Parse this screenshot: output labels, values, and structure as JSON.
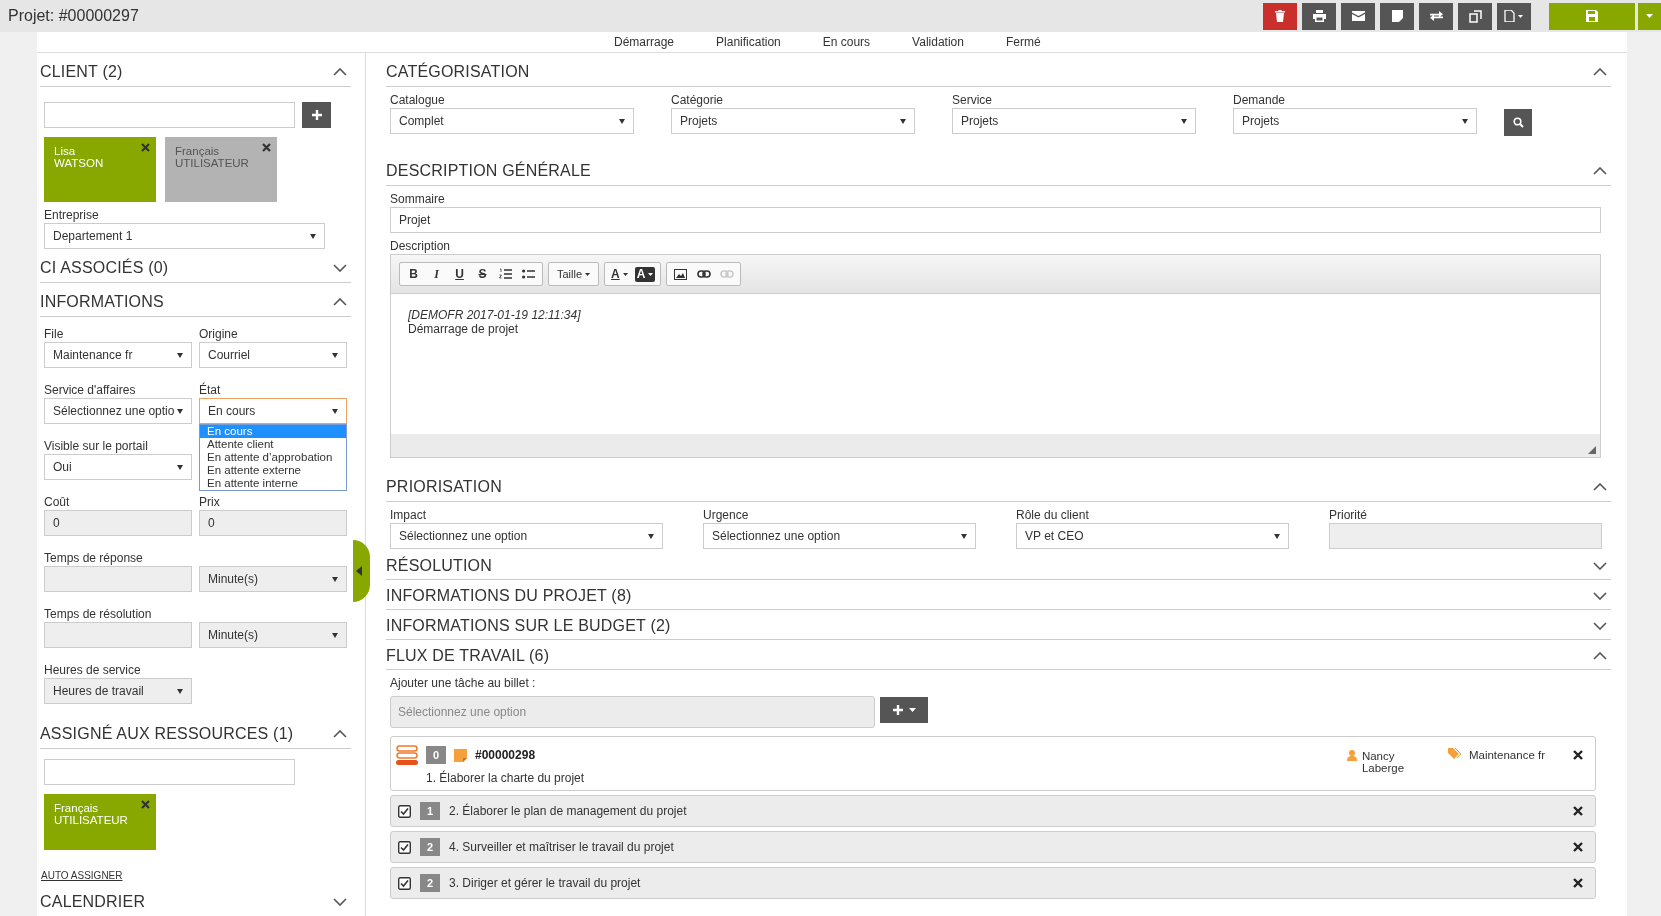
{
  "title": "Projet: #00000297",
  "toolbar": [
    {
      "kind": "delete"
    },
    {
      "kind": "print"
    },
    {
      "kind": "mail"
    },
    {
      "kind": "note"
    },
    {
      "kind": "swap"
    },
    {
      "kind": "copy"
    },
    {
      "kind": "file"
    }
  ],
  "phases": [
    "Démarrage",
    "Planification",
    "En cours",
    "Validation",
    "Fermé"
  ],
  "client": {
    "title": "CLIENT (2)",
    "expanded": true,
    "tags": [
      {
        "first": "Lisa",
        "last": "WATSON",
        "color": "#88a800"
      },
      {
        "first": "Français",
        "last": "UTILISATEUR",
        "color": "#b3b3b3"
      }
    ],
    "company_label": "Entreprise",
    "company": "Departement 1"
  },
  "ci": {
    "title": "CI ASSOCIÉS (0)",
    "expanded": false
  },
  "informations": {
    "title": "INFORMATIONS",
    "expanded": true,
    "rows": [
      {
        "cells": [
          {
            "label": "File",
            "value": "Maintenance fr",
            "kind": "select",
            "disabled": false
          },
          {
            "label": "Origine",
            "value": "Courriel",
            "kind": "select",
            "disabled": false
          }
        ]
      },
      {
        "cells": [
          {
            "label": "Service d'affaires",
            "value": "Sélectionnez une optio",
            "kind": "select",
            "disabled": false
          },
          {
            "label": "État",
            "value": "En cours",
            "kind": "select",
            "disabled": false,
            "open": true,
            "options": [
              {
                "label": "En cours",
                "selected": true
              },
              {
                "label": "Attente client",
                "selected": false
              },
              {
                "label": "En attente d’approbation",
                "selected": false
              },
              {
                "label": "En attente externe",
                "selected": false
              },
              {
                "label": "En attente interne",
                "selected": false
              }
            ]
          }
        ]
      },
      {
        "cells": [
          {
            "label": "Visible sur le portail",
            "value": "Oui",
            "kind": "select",
            "disabled": false
          }
        ]
      },
      {
        "cells": [
          {
            "label": "Coût",
            "value": "0",
            "kind": "input",
            "disabled": true
          },
          {
            "label": "Prix",
            "value": "0",
            "kind": "input",
            "disabled": true
          }
        ]
      },
      {
        "cells": [
          {
            "label": "Temps de réponse",
            "kind": "input",
            "disabled": true
          },
          {
            "value": "Minute(s)",
            "kind": "select",
            "disabled": true
          }
        ]
      },
      {
        "cells": [
          {
            "label": "Temps de résolution",
            "kind": "input",
            "disabled": true
          },
          {
            "value": "Minute(s)",
            "kind": "select",
            "disabled": true
          }
        ]
      },
      {
        "cells": [
          {
            "label": "Heures de service",
            "value": "Heures de travail",
            "kind": "select",
            "disabled": true
          }
        ]
      }
    ]
  },
  "resources": {
    "title": "ASSIGNÉ AUX RESSOURCES (1)",
    "expanded": true,
    "tags": [
      {
        "first": "Français",
        "last": "UTILISATEUR",
        "color": "#88a800"
      }
    ],
    "link": "AUTO ASSIGNER"
  },
  "calendar": {
    "title": "CALENDRIER",
    "expanded": false
  },
  "categorisation": {
    "title": "CATÉGORISATION",
    "expanded": true,
    "fields": [
      {
        "label": "Catalogue",
        "value": "Complet"
      },
      {
        "label": "Catégorie",
        "value": "Projets"
      },
      {
        "label": "Service",
        "value": "Projets"
      },
      {
        "label": "Demande",
        "value": "Projets"
      }
    ]
  },
  "description": {
    "title": "DESCRIPTION GÉNÉRALE",
    "expanded": true,
    "summary_label": "Sommaire",
    "summary": "Projet",
    "description_label": "Description",
    "tool_groups": [
      [
        {
          "kind": "bold",
          "label": "B",
          "disabled": false
        },
        {
          "kind": "italic",
          "label": "I",
          "disabled": false
        },
        {
          "kind": "underline",
          "label": "U",
          "disabled": false
        },
        {
          "kind": "strike",
          "label": "S",
          "disabled": false
        },
        {
          "kind": "ol",
          "disabled": false
        },
        {
          "kind": "ul",
          "disabled": false
        }
      ],
      [
        {
          "kind": "size",
          "label": "Taille",
          "disabled": false
        }
      ],
      [
        {
          "kind": "fore",
          "label": "A",
          "disabled": false
        },
        {
          "kind": "back",
          "label": "A",
          "disabled": false
        }
      ],
      [
        {
          "kind": "image",
          "disabled": false
        },
        {
          "kind": "link",
          "disabled": false
        },
        {
          "kind": "unlink",
          "disabled": true
        }
      ]
    ],
    "lines": [
      {
        "kind": "stamp",
        "text": "[DEMOFR 2017-01-19 12:11:34]"
      },
      {
        "kind": "text",
        "text": "Démarrage de projet"
      }
    ]
  },
  "priorisation": {
    "title": "PRIORISATION",
    "expanded": true,
    "fields": [
      {
        "label": "Impact",
        "value": "Sélectionnez une option",
        "kind": "select"
      },
      {
        "label": "Urgence",
        "value": "Sélectionnez une option",
        "kind": "select"
      },
      {
        "label": "Rôle du client",
        "value": "VP et CEO",
        "kind": "select"
      },
      {
        "label": "Priorité",
        "kind": "input"
      }
    ]
  },
  "collapsed": [
    {
      "title": "RÉSOLUTION",
      "expanded": false
    },
    {
      "title": "INFORMATIONS DU PROJET (8)",
      "expanded": false
    },
    {
      "title": "INFORMATIONS SUR LE BUDGET (2)",
      "expanded": false
    }
  ],
  "workflow": {
    "title": "FLUX DE TRAVAIL (6)",
    "expanded": true,
    "add_label": "Ajouter une tâche au billet :",
    "add_placeholder": "Sélectionnez une option",
    "tasks": [
      {
        "kind": "detail",
        "order": "0",
        "number": "#00000298",
        "name": "1. Élaborer la charte du projet",
        "assignee": "Nancy Laberge",
        "queue": "Maintenance fr"
      },
      {
        "kind": "row",
        "checked": true,
        "order": "1",
        "name": "2. Élaborer le plan de management du projet"
      },
      {
        "kind": "row",
        "checked": true,
        "order": "2",
        "name": "4. Surveiller et maîtriser le travail du projet"
      },
      {
        "kind": "row",
        "checked": true,
        "order": "2",
        "name": "3. Diriger et gérer le travail du projet"
      }
    ]
  }
}
